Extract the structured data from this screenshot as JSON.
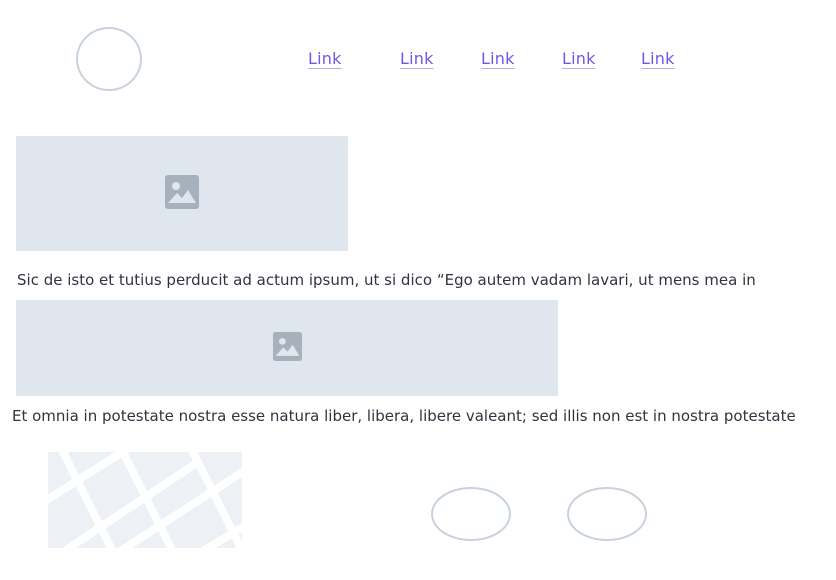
{
  "header": {
    "logo_icon": "circle-logo-placeholder",
    "nav_links": [
      "Link",
      "Link",
      "Link",
      "Link",
      "Link"
    ],
    "link_color": "#6b59e8"
  },
  "content": {
    "image_icon": "image-icon",
    "placeholder_color": "#e0e6ee",
    "paragraph_1": "Sic de isto et tutius perducit ad actum ipsum, ut si dico “Ego autem vadam lavari, ut mens mea in",
    "paragraph_2": "Et omnia in potestate nostra esse natura liber, libera, libere valeant; sed illis non est in nostra potestate"
  },
  "footer": {
    "map_icon": "map-placeholder",
    "buttons": [
      "oval-placeholder",
      "oval-placeholder"
    ]
  }
}
